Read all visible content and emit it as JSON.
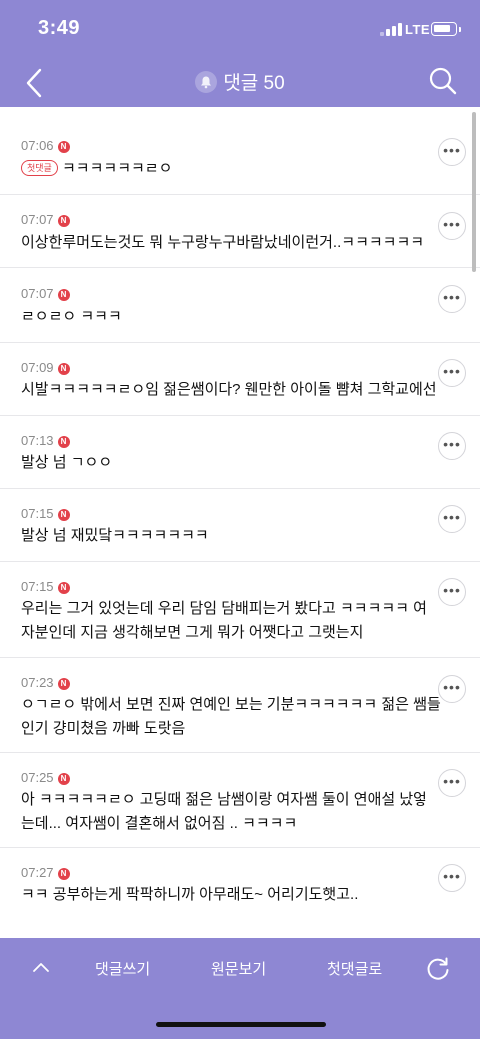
{
  "status_bar": {
    "time": "3:49",
    "network": "LTE"
  },
  "header": {
    "title": "댓글 50"
  },
  "comments": [
    {
      "time": "07:06",
      "badge": "N",
      "first_badge": "첫댓글",
      "text": "ㅋㅋㅋㅋㅋㅋㄹㅇ"
    },
    {
      "time": "07:07",
      "badge": "N",
      "text": "이상한루머도는것도 뭐 누구랑누구바람났네이런거..ㅋㅋㅋㅋㅋㅋ"
    },
    {
      "time": "07:07",
      "badge": "N",
      "text": "ㄹㅇㄹㅇ ㅋㅋㅋ"
    },
    {
      "time": "07:09",
      "badge": "N",
      "text": "시발ㅋㅋㅋㅋㅋㄹㅇ임 젊은쌤이다? 웬만한 아이돌 뺨쳐 그학교에선"
    },
    {
      "time": "07:13",
      "badge": "N",
      "text": "발상 넘 ㄱㅇㅇ"
    },
    {
      "time": "07:15",
      "badge": "N",
      "text": "발상 넘 재밌닼ㅋㅋㅋㅋㅋㅋㅋ"
    },
    {
      "time": "07:15",
      "badge": "N",
      "text": "우리는 그거 있엇는데 우리 담임 담배피는거 봤다고 ㅋㅋㅋㅋㅋ 여\n자분인데 지금 생각해보면 그게 뭐가 어쨋다고 그랫는지"
    },
    {
      "time": "07:23",
      "badge": "N",
      "text": "ㅇㄱㄹㅇ 밖에서 보면 진짜 연예인 보는 기분ㅋㅋㅋㅋㅋㅋ 젊은 쌤들\n인기 걍미쳤음 까빠 도랏음"
    },
    {
      "time": "07:25",
      "badge": "N",
      "text": "아 ㅋㅋㅋㅋㅋㄹㅇ 고딩때 젊은 남쌤이랑 여자쌤 둘이 연애설 났엏\n는데... 여자쌤이 결혼해서 없어짐 .. ㅋㅋㅋㅋ"
    },
    {
      "time": "07:27",
      "badge": "N",
      "text": "ㅋㅋ 공부하는게 팍팍하니까 아무래도~ 어리기도햇고.."
    }
  ],
  "more_label": "•••",
  "bottom_bar": {
    "write_label": "댓글쓰기",
    "original_label": "원문보기",
    "first_label": "첫댓글로"
  },
  "icons": {
    "back": "chevron-left-icon",
    "bell": "bell-icon",
    "search": "search-icon",
    "up": "chevron-up-icon",
    "refresh": "refresh-icon"
  },
  "colors": {
    "accent": "#8e87d3",
    "new_badge": "#e2414a"
  }
}
